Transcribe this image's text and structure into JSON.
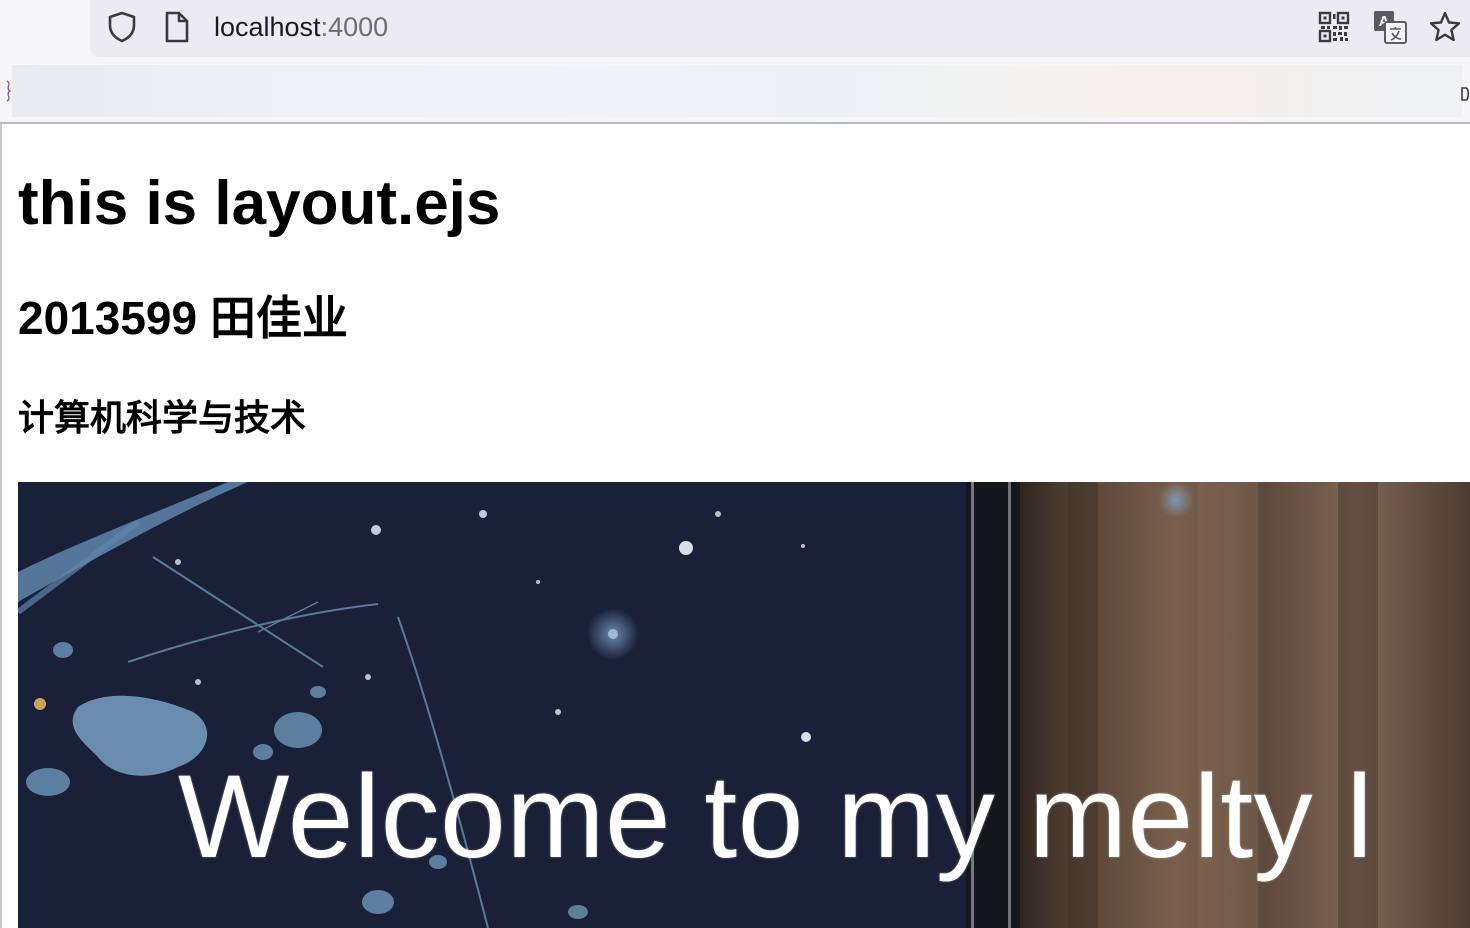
{
  "browser": {
    "url_host": "localhost",
    "url_port": ":4000",
    "icons": {
      "security": "shield-icon",
      "page": "page-icon",
      "qr": "qr-code-icon",
      "translate": "translate-icon",
      "bookmark": "star-icon"
    }
  },
  "page": {
    "title": "this is layout.ejs",
    "student_line": "2013599 田佳业",
    "major": "计算机科学与技术"
  },
  "banner": {
    "text": "Welcome to my melty l",
    "colors": {
      "night_sky": "#1a2038",
      "splash": "#6d8fae",
      "wood": "#6b5444"
    }
  }
}
